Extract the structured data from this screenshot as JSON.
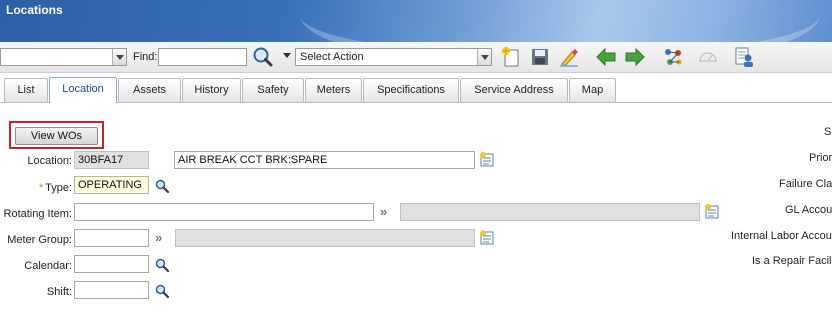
{
  "window": {
    "title": "Locations"
  },
  "toolbar": {
    "query_select_value": "",
    "find_label": "Find:",
    "find_value": "",
    "action_select_value": "Select Action",
    "icons": [
      "new-record-icon",
      "save-icon",
      "clear-changes-icon",
      "previous-record-icon",
      "next-record-icon",
      "route-workflow-icon",
      "display-status-icon",
      "view-history-icon"
    ]
  },
  "tabs": [
    {
      "label": "List"
    },
    {
      "label": "Location",
      "active": true
    },
    {
      "label": "Assets"
    },
    {
      "label": "History"
    },
    {
      "label": "Safety"
    },
    {
      "label": "Meters"
    },
    {
      "label": "Specifications"
    },
    {
      "label": "Service Address"
    },
    {
      "label": "Map"
    }
  ],
  "form": {
    "view_wos_label": "View WOs",
    "location_label": "Location:",
    "location_value": "30BFA17",
    "description_value": "AIR BREAK CCT BRK:SPARE",
    "type_required": "*",
    "type_label": "Type:",
    "type_value": "OPERATING",
    "rotating_item_label": "Rotating Item:",
    "rotating_item_value": "",
    "rotating_item_desc": "",
    "meter_group_label": "Meter Group:",
    "meter_group_value": "",
    "meter_group_desc": "",
    "calendar_label": "Calendar:",
    "calendar_value": "",
    "shift_label": "Shift:",
    "shift_value": ""
  },
  "right_column": {
    "labels": [
      "S",
      "Prior",
      "Failure Clas",
      "GL Accou",
      "Internal Labor Accou",
      "Is a Repair Facili"
    ]
  }
}
